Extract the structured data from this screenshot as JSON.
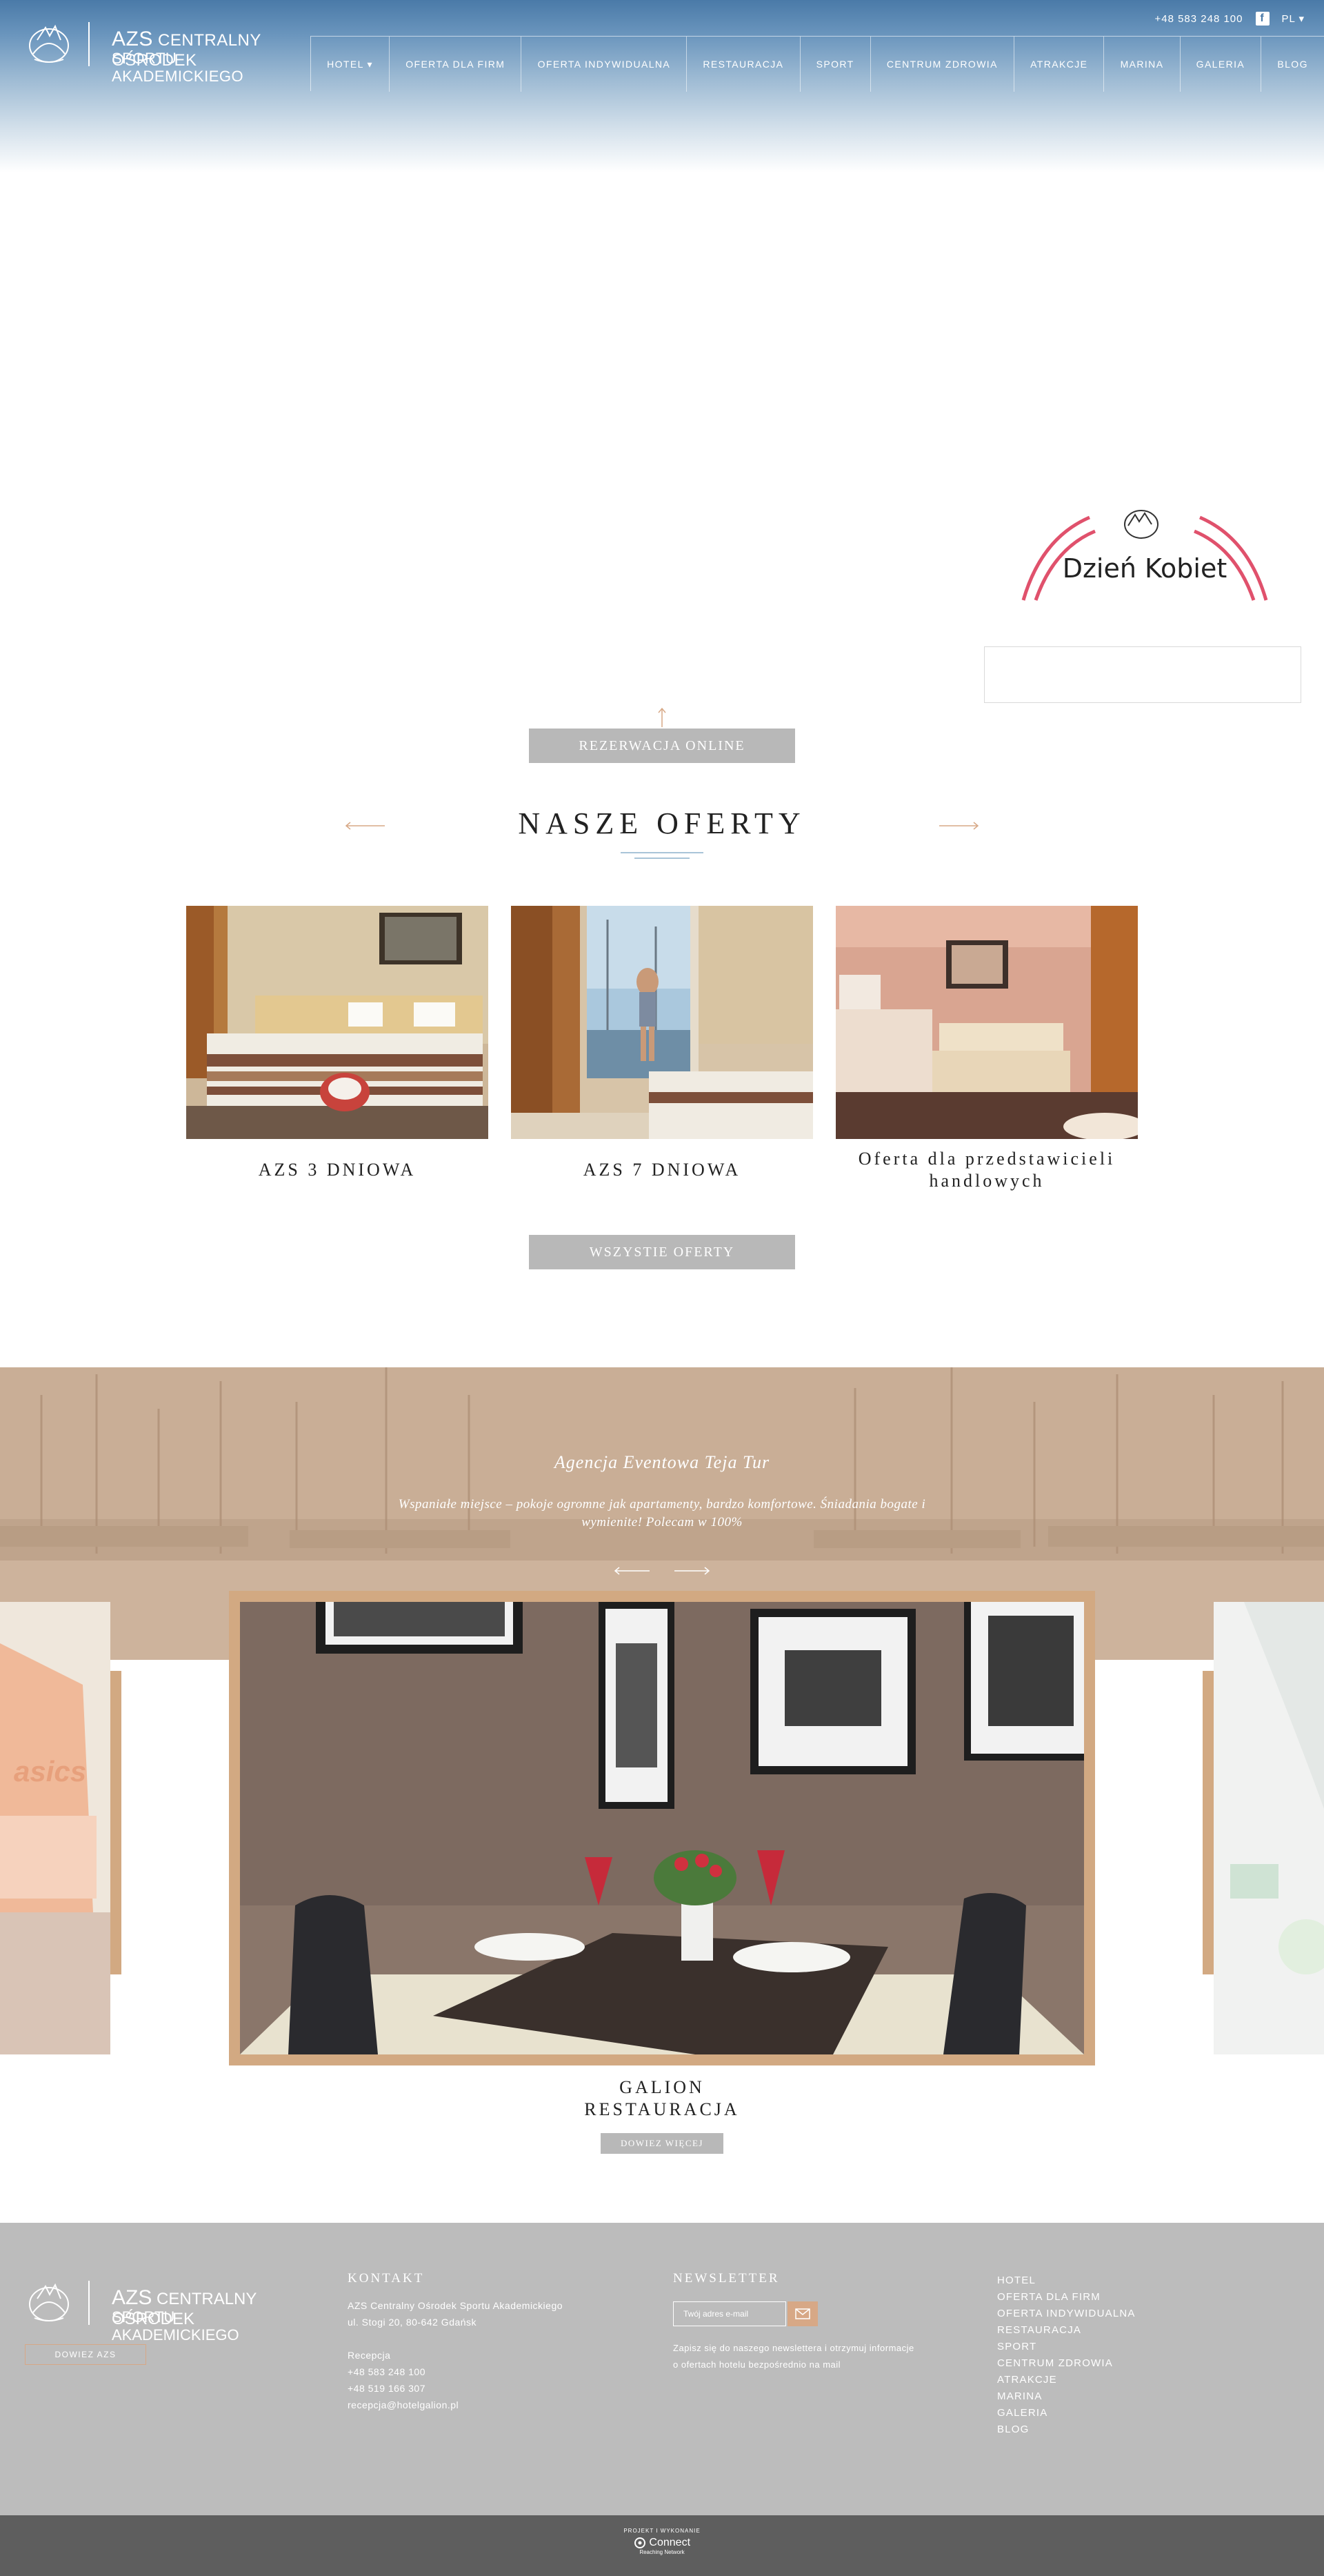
{
  "header": {
    "logo_brand": "AZS",
    "logo_line1_rest": "CENTRALNY OŚRODEK",
    "logo_line2": "SPORTU AKADEMICKIEGO",
    "phone": "+48 583 248 100",
    "facebook_icon": "f",
    "language": "PL ▾"
  },
  "nav": [
    "HOTEL ▾",
    "OFERTA DLA FIRM",
    "OFERTA INDYWIDUALNA",
    "RESTAURACJA",
    "SPORT",
    "CENTRUM ZDROWIA",
    "ATRAKCJE",
    "MARINA",
    "GALERIA",
    "BLOG"
  ],
  "promo": {
    "title": "Dzień Kobiet"
  },
  "booking": {
    "button": "REZERWACJA ONLINE"
  },
  "offers": {
    "title": "NASZE OFERTY",
    "items": [
      {
        "title": "AZS 3 DNIOWA"
      },
      {
        "title": "AZS 7 DNIOWA"
      },
      {
        "title": "Oferta dla przedstawicieli handlowych"
      }
    ],
    "all_button": "WSZYSTIE OFERTY"
  },
  "testimonial": {
    "author": "Agencja Eventowa Teja Tur",
    "text": "Wspaniałe miejsce – pokoje ogromne jak apartamenty, bardzo komfortowe. Śniadania bogate i wymienite! Polecam w 100%"
  },
  "gallery": {
    "caption_line1": "GALION",
    "caption_line2": "RESTAURACJA",
    "more_button": "DOWIEZ WIĘCEJ"
  },
  "footer": {
    "logo_brand": "AZS",
    "logo_line1_rest": "CENTRALNY OŚRODEK",
    "logo_line2": "SPORTU AKADEMICKIEGO",
    "find_button": "DOWIEZ AZS",
    "contact": {
      "heading": "KONTAKT",
      "name": "AZS Centralny Ośrodek Sportu Akademickiego",
      "address": "ul. Stogi 20, 80-642 Gdańsk",
      "reception_label": "Recepcja",
      "phone1": "+48 583 248 100",
      "phone2": "+48 519 166 307",
      "email": "recepcja@hotelgalion.pl"
    },
    "newsletter": {
      "heading": "NEWSLETTER",
      "placeholder": "Twój adres e-mail",
      "text": "Zapisz się do naszego newslettera i otrzymuj informacje o ofertach hotelu bezpośrednio na mail"
    },
    "menu": [
      "HOTEL",
      "OFERTA DLA FIRM",
      "OFERTA INDYWIDUALNA",
      "RESTAURACJA",
      "SPORT",
      "CENTRUM ZDROWIA",
      "ATRAKCJE",
      "MARINA",
      "GALERIA",
      "BLOG"
    ]
  },
  "credit": {
    "label": "PROJEKT I WYKONANIE",
    "brand": "Connect",
    "sub": "Reaching Network"
  },
  "colors": {
    "header_blue": "#4a7aa8",
    "accent_tan": "#d2a982",
    "button_gray": "#b8b8b8",
    "footer_gray": "#bcbcbc",
    "bottom_bar": "#5e5e5e",
    "promo_pink": "#e0516c"
  }
}
